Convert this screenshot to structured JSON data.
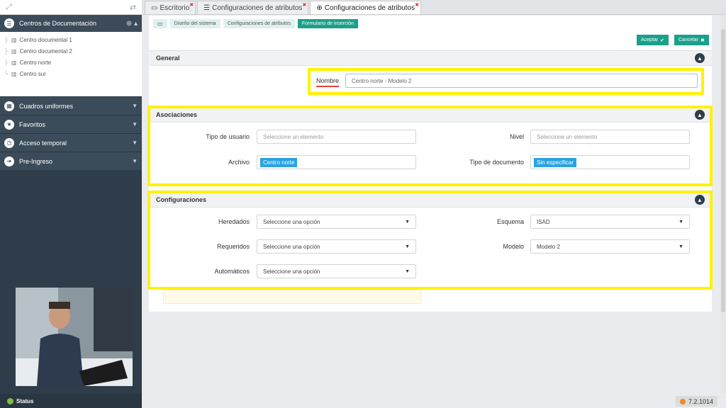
{
  "sidebar": {
    "header_label": "Centros de Documentación",
    "tree_items": [
      "Centro documental 1",
      "Centro documental 2",
      "Centro norte",
      "Centro sur"
    ],
    "sections": [
      {
        "label": "Cuadros uniformes",
        "icon": "grid-icon"
      },
      {
        "label": "Favoritos",
        "icon": "star-icon"
      },
      {
        "label": "Acceso temporal",
        "icon": "clock-icon"
      },
      {
        "label": "Pre-Ingreso",
        "icon": "login-icon"
      }
    ],
    "status_label": "Status"
  },
  "tabs": [
    {
      "label": "Escritorio",
      "icon": "monitor-icon",
      "active": false
    },
    {
      "label": "Configuraciones de atributos",
      "icon": "list-icon",
      "active": false
    },
    {
      "label": "Configuraciones de atributos",
      "icon": "plus-circle-icon",
      "active": true
    }
  ],
  "breadcrumb": [
    "Diseño del sistema",
    "Configuraciones de atributos",
    "Formulario de inserción"
  ],
  "actions": {
    "accept": "Aceptar",
    "cancel": "Cancelar"
  },
  "general": {
    "title": "General",
    "nombre_label": "Nombre",
    "nombre_value": "Centro norte - Modelo 2"
  },
  "asociaciones": {
    "title": "Asociaciones",
    "tipo_usuario_label": "Tipo de usuario",
    "tipo_usuario_placeholder": "Seleccione un elemento",
    "nivel_label": "Nivel",
    "nivel_placeholder": "Seleccione un elemento",
    "archivo_label": "Archivo",
    "archivo_value": "Centro norte",
    "tipo_documento_label": "Tipo de documento",
    "tipo_documento_value": "Sin especificar"
  },
  "configuraciones": {
    "title": "Configuraciones",
    "heredados_label": "Heredados",
    "heredados_value": "Seleccione una opción",
    "esquema_label": "Esquema",
    "esquema_value": "ISAD",
    "requeridos_label": "Requeridos",
    "requeridos_value": "Seleccione una opción",
    "modelo_label": "Modelo",
    "modelo_value": "Modelo 2",
    "automaticos_label": "Automáticos",
    "automaticos_value": "Seleccione una opción"
  },
  "version": "7.2.1014",
  "colors": {
    "accent": "#1aa08b",
    "highlight": "#fff200",
    "tag": "#2aa3e0",
    "sidebar": "#2f3d4a"
  }
}
